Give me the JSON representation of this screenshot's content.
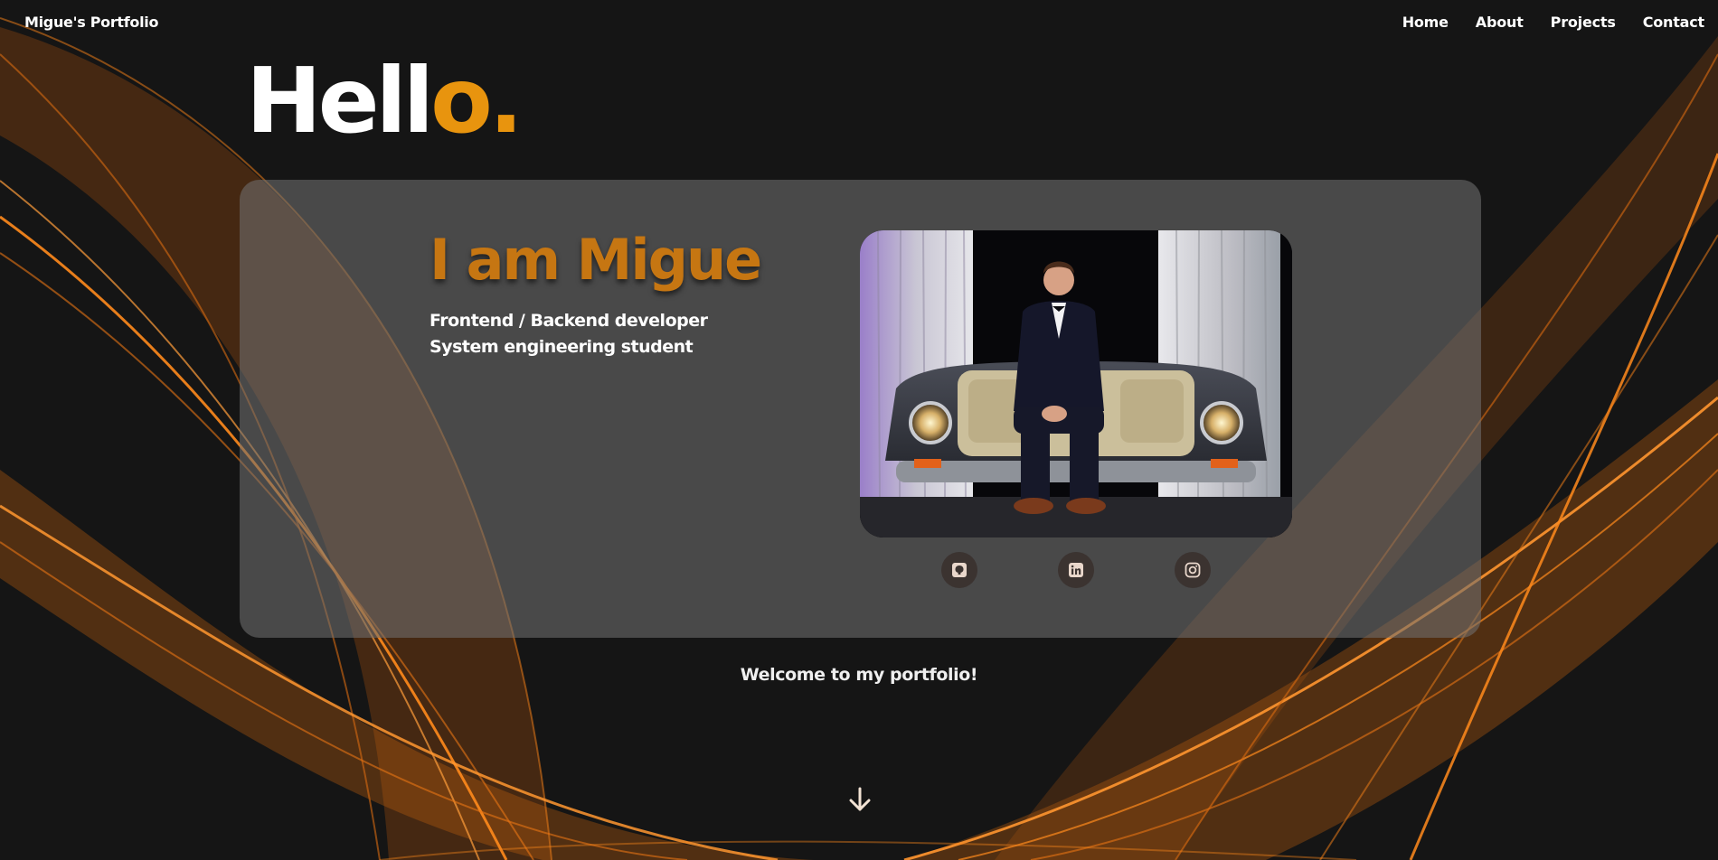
{
  "brand": "Migue's Portfolio",
  "nav": {
    "home": "Home",
    "about": "About",
    "projects": "Projects",
    "contact": "Contact"
  },
  "hero": {
    "hello_main": "Hell",
    "hello_accent": "o.",
    "title": "I am Migue",
    "subtitle_line1": "Frontend / Backend developer",
    "subtitle_line2": "System engineering student",
    "photo_alt": "Migue sitting on a car-front sofa"
  },
  "socials": [
    {
      "name": "github",
      "icon": "github-icon"
    },
    {
      "name": "linkedin",
      "icon": "linkedin-icon"
    },
    {
      "name": "instagram",
      "icon": "instagram-icon"
    }
  ],
  "welcome": "Welcome to my portfolio!",
  "scroll_icon": "arrow-down-icon",
  "colors": {
    "background": "#151515",
    "accent": "#e8940e",
    "title": "#c67612",
    "card": "#707070",
    "wave": "#ff8a1c"
  }
}
